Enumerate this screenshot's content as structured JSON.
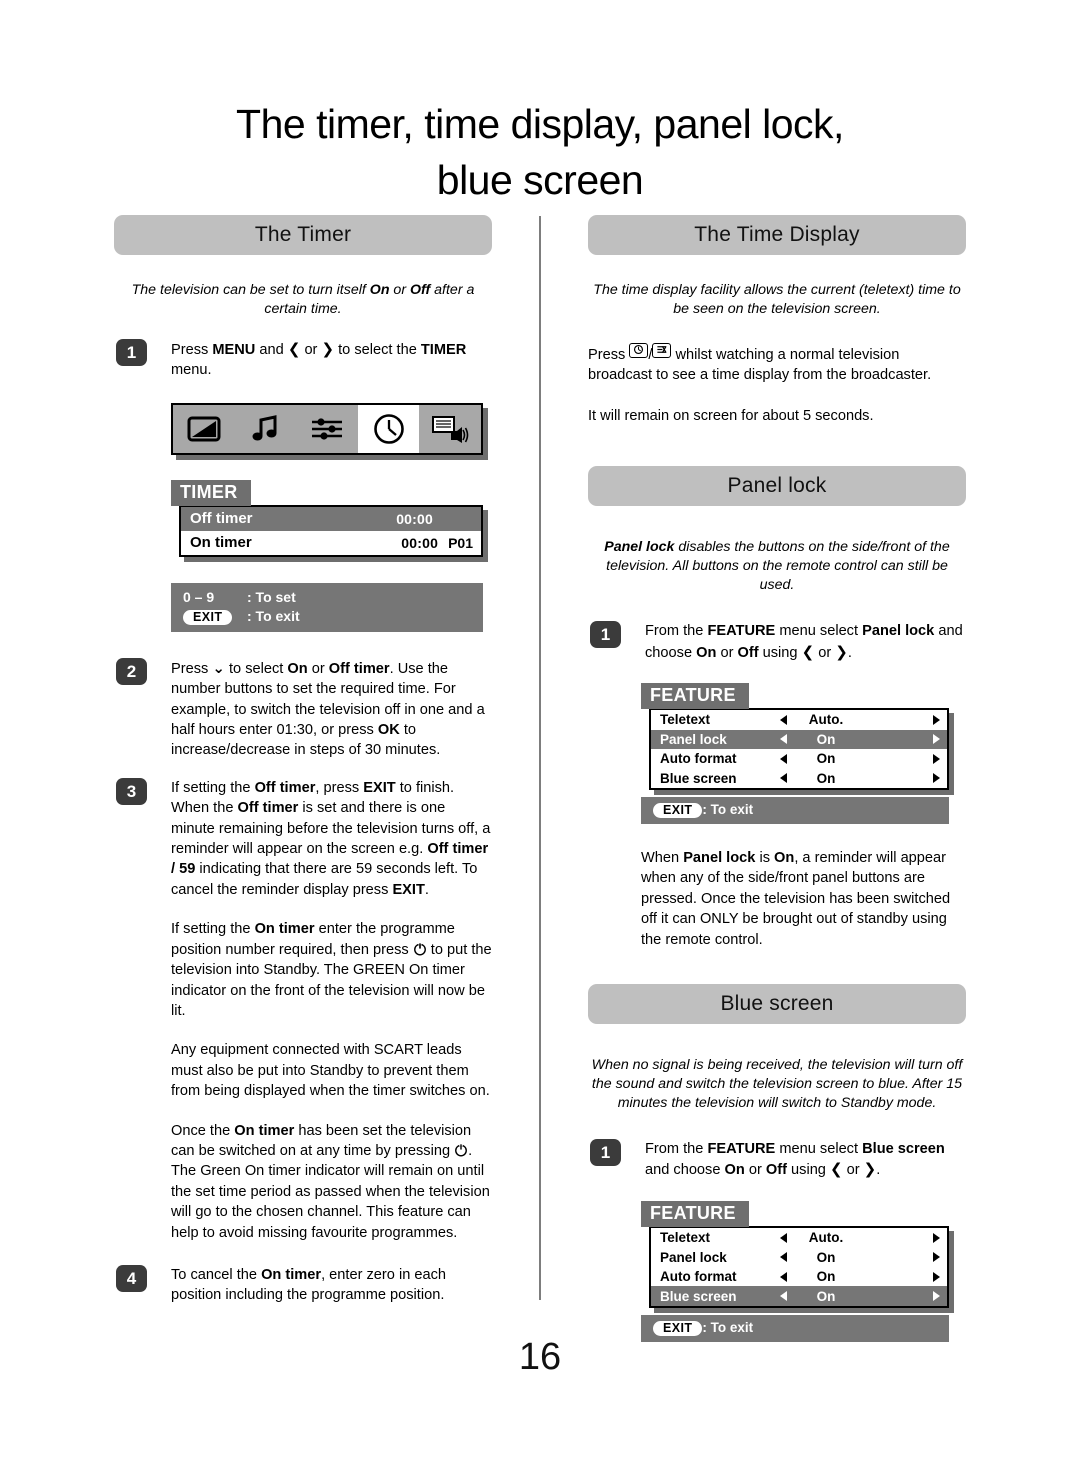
{
  "title": {
    "line1": "The timer, time display, panel lock,",
    "line2": "blue screen"
  },
  "page_number": "16",
  "left_column": {
    "banner": "The Timer",
    "intro": "The television can be set to turn itself On or Off after a certain time.",
    "intro_parts": {
      "a": "The television can be set to turn itself ",
      "b1": "On",
      "c": " or ",
      "b2": "Off",
      "d": " after a certain time."
    },
    "step1": {
      "badge": "1",
      "parts": {
        "a": "Press ",
        "b1": "MENU",
        "c": " and ",
        "arrow_left": "❮",
        "d": " or ",
        "arrow_right": "❯",
        "e": " to select the ",
        "b2": "TIMER",
        "f": " menu."
      }
    },
    "icon_bar": {
      "icons": [
        "picture-icon",
        "sound-icon",
        "feature-icon",
        "timer-clock-icon",
        "teletext-speaker-icon"
      ],
      "selected_index": 3
    },
    "timer_osd": {
      "tab": "TIMER",
      "rows": [
        {
          "label": "Off timer",
          "value": "00:00",
          "value2": "",
          "highlight": true
        },
        {
          "label": "On timer",
          "value": "00:00",
          "value2": "P01",
          "highlight": false
        }
      ],
      "help": [
        {
          "key": "0 – 9",
          "pill": false,
          "text": ": To set"
        },
        {
          "key": "EXIT",
          "pill": true,
          "text": ": To exit"
        }
      ]
    },
    "step2": {
      "badge": "2",
      "parts": {
        "a": "Press ",
        "chevron_down": "⌄",
        "b": " to select ",
        "b1": "On",
        "c": " or ",
        "b2": "Off timer",
        "d": ". Use the number buttons to set the required time. For example, to switch the television off in one and a half hours enter 01:30, or press ",
        "b3": "OK",
        "e": " to increase/decrease in steps of 30 minutes."
      }
    },
    "step3": {
      "badge": "3",
      "parts": {
        "a": "If setting the ",
        "b1": "Off timer",
        "c": ", press ",
        "b2": "EXIT",
        "d": " to finish. When the ",
        "b3": "Off timer",
        "e": " is set and there is one minute remaining before the television turns off, a reminder will appear on the screen e.g. ",
        "b4": "Off timer / 59",
        "f": " indicating that there are 59 seconds left. To cancel the reminder display press ",
        "b5": "EXIT",
        "g": "."
      }
    },
    "para_on_timer": {
      "a": "If setting the ",
      "b1": "On timer",
      "c": " enter the programme position number required, then press ",
      "power": "power-icon",
      "d": " to put the television into Standby. The GREEN On timer indicator on the front of the television will now be lit."
    },
    "para_scart": "Any equipment connected with SCART leads must also be put into Standby to prevent them from being displayed when the timer switches on.",
    "para_once": {
      "a": "Once the ",
      "b1": "On timer",
      "c": " has been set the television can be switched on at any time by pressing ",
      "power": "power-icon",
      "d": ". The Green On timer indicator will remain on until the set time period as passed when the television will go to the chosen channel. This feature can help to avoid missing favourite programmes."
    },
    "step4": {
      "badge": "4",
      "parts": {
        "a": "To cancel the ",
        "b1": "On timer",
        "c": ", enter zero in each position including the programme position."
      }
    }
  },
  "right_column": {
    "time_display": {
      "banner": "The Time Display",
      "intro": "The time display facility allows the current (teletext) time to be seen on the television screen.",
      "para1": {
        "a": "Press ",
        "icon1": "clock-key-icon",
        "slash": "/",
        "icon2": "cancel-key-icon",
        "b": " whilst watching a normal television broadcast to see a time display from the broadcaster."
      },
      "para2": "It will remain on screen for about 5 seconds."
    },
    "panel_lock": {
      "banner": "Panel lock",
      "intro": {
        "b": "Panel lock",
        "a": " disables the buttons on the side/front of the television. All buttons on the remote control can still be used."
      },
      "step1": {
        "badge": "1",
        "parts": {
          "a": "From the ",
          "b1": "FEATURE",
          "c": " menu select ",
          "b2": "Panel lock",
          "d": " and choose ",
          "b3": "On",
          "e": " or ",
          "b4": "Off",
          "f": " using ",
          "arrow_left": "❮",
          "g": " or ",
          "arrow_right": "❯",
          "h": "."
        }
      },
      "feature_osd": {
        "tab": "FEATURE",
        "rows": [
          {
            "label": "Teletext",
            "value": "Auto.",
            "highlight": false
          },
          {
            "label": "Panel lock",
            "value": "On",
            "highlight": true
          },
          {
            "label": "Auto format",
            "value": "On",
            "highlight": false
          },
          {
            "label": "Blue screen",
            "value": "On",
            "highlight": false
          }
        ],
        "help_pill": "EXIT",
        "help_text": ": To exit"
      },
      "after": {
        "a": "When ",
        "b1": "Panel lock",
        "c": " is ",
        "b2": "On",
        "d": ", a reminder will appear when any of the side/front panel buttons are pressed. Once the television has been switched off it can ONLY be brought out of standby using the remote control."
      }
    },
    "blue_screen": {
      "banner": "Blue screen",
      "intro": "When no signal is being received, the television will turn off the sound and switch the television screen to blue. After 15 minutes the television will switch to Standby mode.",
      "step1": {
        "badge": "1",
        "parts": {
          "a": "From the ",
          "b1": "FEATURE",
          "c": " menu select ",
          "b2": "Blue screen",
          "d": " and choose ",
          "b3": "On",
          "e": " or ",
          "b4": "Off",
          "f": " using ",
          "arrow_left": "❮",
          "g": " or ",
          "arrow_right": "❯",
          "h": "."
        }
      },
      "feature_osd": {
        "tab": "FEATURE",
        "rows": [
          {
            "label": "Teletext",
            "value": "Auto.",
            "highlight": false
          },
          {
            "label": "Panel lock",
            "value": "On",
            "highlight": false
          },
          {
            "label": "Auto format",
            "value": "On",
            "highlight": false
          },
          {
            "label": "Blue screen",
            "value": "On",
            "highlight": true
          }
        ],
        "help_pill": "EXIT",
        "help_text": ": To exit"
      }
    }
  },
  "colors": {
    "banner_gray": "#bfbfbf",
    "osd_gray": "#767676",
    "badge_dark": "#3b3b3b",
    "shadow_gray": "#6e6e6e",
    "iconbar_gray": "#a8a8a8"
  }
}
